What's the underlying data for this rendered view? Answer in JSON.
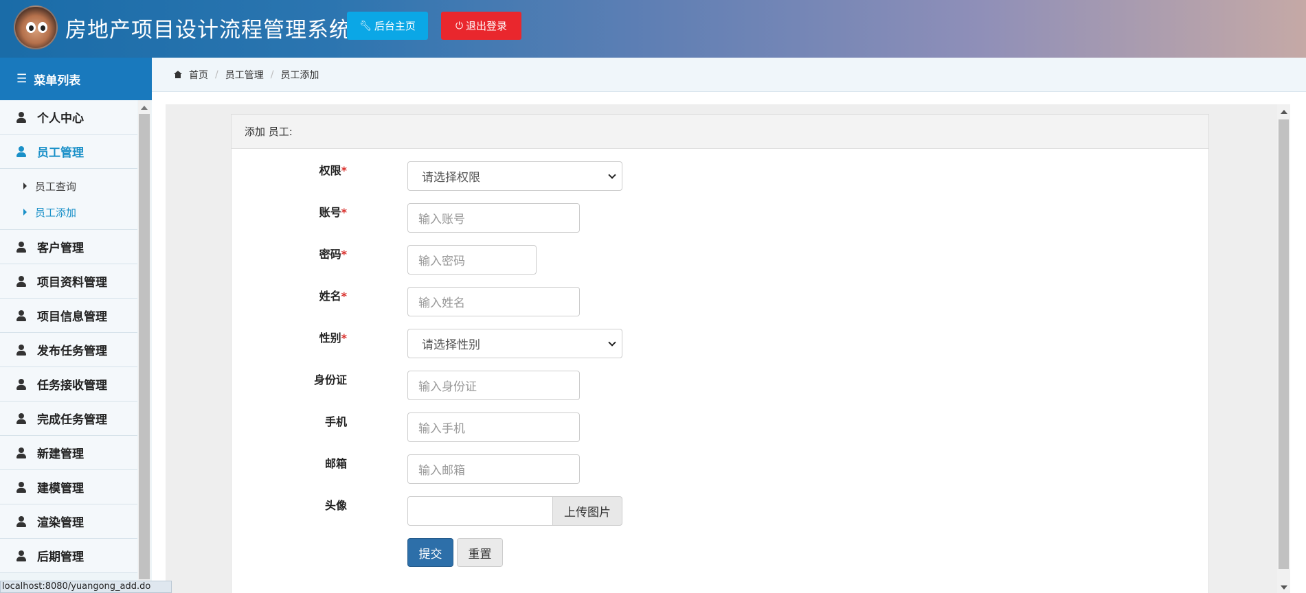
{
  "header": {
    "title": "房地产项目设计流程管理系统",
    "home_button": "后台主页",
    "logout_button": "退出登录"
  },
  "sidebar": {
    "title": "菜单列表",
    "items": [
      {
        "label": "个人中心"
      },
      {
        "label": "员工管理",
        "active": true,
        "children": [
          {
            "label": "员工查询"
          },
          {
            "label": "员工添加",
            "active": true
          }
        ]
      },
      {
        "label": "客户管理"
      },
      {
        "label": "项目资料管理"
      },
      {
        "label": "项目信息管理"
      },
      {
        "label": "发布任务管理"
      },
      {
        "label": "任务接收管理"
      },
      {
        "label": "完成任务管理"
      },
      {
        "label": "新建管理"
      },
      {
        "label": "建模管理"
      },
      {
        "label": "渲染管理"
      },
      {
        "label": "后期管理"
      }
    ]
  },
  "breadcrumb": [
    "首页",
    "员工管理",
    "员工添加"
  ],
  "panel": {
    "title": "添加 员工:"
  },
  "form": {
    "permission": {
      "label": "权限",
      "value": "请选择权限",
      "required": true
    },
    "account": {
      "label": "账号",
      "placeholder": "输入账号",
      "required": true
    },
    "password": {
      "label": "密码",
      "placeholder": "输入密码",
      "required": true
    },
    "name": {
      "label": "姓名",
      "placeholder": "输入姓名",
      "required": true
    },
    "gender": {
      "label": "性别",
      "value": "请选择性别",
      "required": true
    },
    "idcard": {
      "label": "身份证",
      "placeholder": "输入身份证"
    },
    "phone": {
      "label": "手机",
      "placeholder": "输入手机"
    },
    "email": {
      "label": "邮箱",
      "placeholder": "输入邮箱"
    },
    "avatar": {
      "label": "头像",
      "upload_button": "上传图片"
    },
    "submit_button": "提交",
    "reset_button": "重置",
    "required_mark": "*"
  },
  "status_bar": "localhost:8080/yuangong_add.do",
  "colors": {
    "header_start": "#1a6ca8",
    "header_end": "#c5a9a6",
    "home_button": "#0ba7e6",
    "logout_button": "#e9272d",
    "sidebar_head": "#1979bd",
    "active": "#1a90c8",
    "primary_button": "#2d6fa9",
    "required": "#d9302c"
  }
}
